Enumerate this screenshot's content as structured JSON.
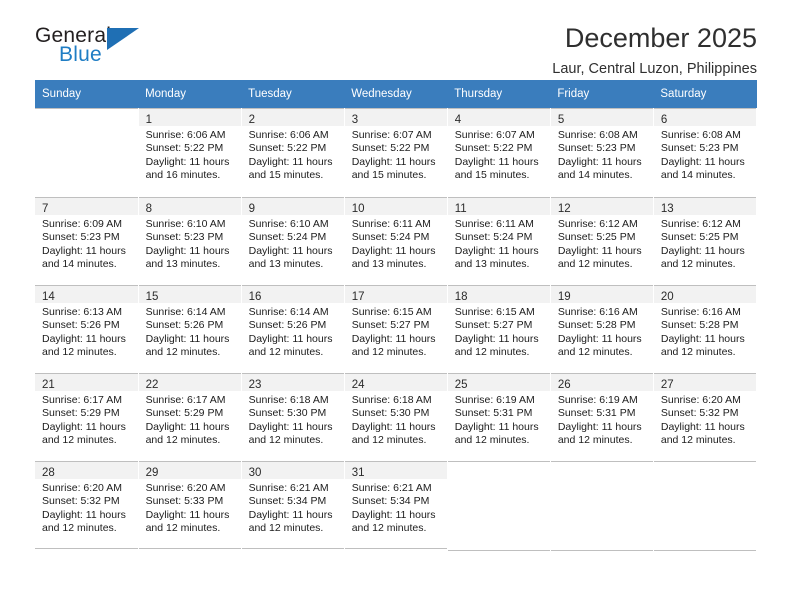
{
  "logo": {
    "word_top": "General",
    "word_bottom": "Blue",
    "triangle_color": "#1f6fb4",
    "blue_color": "#1f7dc4"
  },
  "header": {
    "title": "December 2025",
    "subtitle": "Laur, Central Luzon, Philippines"
  },
  "calendar": {
    "header_bg": "#3a7dbd",
    "daynum_bg": "#f2f2f2",
    "weekday_headers": [
      "Sunday",
      "Monday",
      "Tuesday",
      "Wednesday",
      "Thursday",
      "Friday",
      "Saturday"
    ],
    "weeks": [
      [
        {
          "day": "",
          "sunrise": "",
          "sunset": "",
          "daylight1": "",
          "daylight2": ""
        },
        {
          "day": "1",
          "sunrise": "Sunrise: 6:06 AM",
          "sunset": "Sunset: 5:22 PM",
          "daylight1": "Daylight: 11 hours",
          "daylight2": "and 16 minutes."
        },
        {
          "day": "2",
          "sunrise": "Sunrise: 6:06 AM",
          "sunset": "Sunset: 5:22 PM",
          "daylight1": "Daylight: 11 hours",
          "daylight2": "and 15 minutes."
        },
        {
          "day": "3",
          "sunrise": "Sunrise: 6:07 AM",
          "sunset": "Sunset: 5:22 PM",
          "daylight1": "Daylight: 11 hours",
          "daylight2": "and 15 minutes."
        },
        {
          "day": "4",
          "sunrise": "Sunrise: 6:07 AM",
          "sunset": "Sunset: 5:22 PM",
          "daylight1": "Daylight: 11 hours",
          "daylight2": "and 15 minutes."
        },
        {
          "day": "5",
          "sunrise": "Sunrise: 6:08 AM",
          "sunset": "Sunset: 5:23 PM",
          "daylight1": "Daylight: 11 hours",
          "daylight2": "and 14 minutes."
        },
        {
          "day": "6",
          "sunrise": "Sunrise: 6:08 AM",
          "sunset": "Sunset: 5:23 PM",
          "daylight1": "Daylight: 11 hours",
          "daylight2": "and 14 minutes."
        }
      ],
      [
        {
          "day": "7",
          "sunrise": "Sunrise: 6:09 AM",
          "sunset": "Sunset: 5:23 PM",
          "daylight1": "Daylight: 11 hours",
          "daylight2": "and 14 minutes."
        },
        {
          "day": "8",
          "sunrise": "Sunrise: 6:10 AM",
          "sunset": "Sunset: 5:23 PM",
          "daylight1": "Daylight: 11 hours",
          "daylight2": "and 13 minutes."
        },
        {
          "day": "9",
          "sunrise": "Sunrise: 6:10 AM",
          "sunset": "Sunset: 5:24 PM",
          "daylight1": "Daylight: 11 hours",
          "daylight2": "and 13 minutes."
        },
        {
          "day": "10",
          "sunrise": "Sunrise: 6:11 AM",
          "sunset": "Sunset: 5:24 PM",
          "daylight1": "Daylight: 11 hours",
          "daylight2": "and 13 minutes."
        },
        {
          "day": "11",
          "sunrise": "Sunrise: 6:11 AM",
          "sunset": "Sunset: 5:24 PM",
          "daylight1": "Daylight: 11 hours",
          "daylight2": "and 13 minutes."
        },
        {
          "day": "12",
          "sunrise": "Sunrise: 6:12 AM",
          "sunset": "Sunset: 5:25 PM",
          "daylight1": "Daylight: 11 hours",
          "daylight2": "and 12 minutes."
        },
        {
          "day": "13",
          "sunrise": "Sunrise: 6:12 AM",
          "sunset": "Sunset: 5:25 PM",
          "daylight1": "Daylight: 11 hours",
          "daylight2": "and 12 minutes."
        }
      ],
      [
        {
          "day": "14",
          "sunrise": "Sunrise: 6:13 AM",
          "sunset": "Sunset: 5:26 PM",
          "daylight1": "Daylight: 11 hours",
          "daylight2": "and 12 minutes."
        },
        {
          "day": "15",
          "sunrise": "Sunrise: 6:14 AM",
          "sunset": "Sunset: 5:26 PM",
          "daylight1": "Daylight: 11 hours",
          "daylight2": "and 12 minutes."
        },
        {
          "day": "16",
          "sunrise": "Sunrise: 6:14 AM",
          "sunset": "Sunset: 5:26 PM",
          "daylight1": "Daylight: 11 hours",
          "daylight2": "and 12 minutes."
        },
        {
          "day": "17",
          "sunrise": "Sunrise: 6:15 AM",
          "sunset": "Sunset: 5:27 PM",
          "daylight1": "Daylight: 11 hours",
          "daylight2": "and 12 minutes."
        },
        {
          "day": "18",
          "sunrise": "Sunrise: 6:15 AM",
          "sunset": "Sunset: 5:27 PM",
          "daylight1": "Daylight: 11 hours",
          "daylight2": "and 12 minutes."
        },
        {
          "day": "19",
          "sunrise": "Sunrise: 6:16 AM",
          "sunset": "Sunset: 5:28 PM",
          "daylight1": "Daylight: 11 hours",
          "daylight2": "and 12 minutes."
        },
        {
          "day": "20",
          "sunrise": "Sunrise: 6:16 AM",
          "sunset": "Sunset: 5:28 PM",
          "daylight1": "Daylight: 11 hours",
          "daylight2": "and 12 minutes."
        }
      ],
      [
        {
          "day": "21",
          "sunrise": "Sunrise: 6:17 AM",
          "sunset": "Sunset: 5:29 PM",
          "daylight1": "Daylight: 11 hours",
          "daylight2": "and 12 minutes."
        },
        {
          "day": "22",
          "sunrise": "Sunrise: 6:17 AM",
          "sunset": "Sunset: 5:29 PM",
          "daylight1": "Daylight: 11 hours",
          "daylight2": "and 12 minutes."
        },
        {
          "day": "23",
          "sunrise": "Sunrise: 6:18 AM",
          "sunset": "Sunset: 5:30 PM",
          "daylight1": "Daylight: 11 hours",
          "daylight2": "and 12 minutes."
        },
        {
          "day": "24",
          "sunrise": "Sunrise: 6:18 AM",
          "sunset": "Sunset: 5:30 PM",
          "daylight1": "Daylight: 11 hours",
          "daylight2": "and 12 minutes."
        },
        {
          "day": "25",
          "sunrise": "Sunrise: 6:19 AM",
          "sunset": "Sunset: 5:31 PM",
          "daylight1": "Daylight: 11 hours",
          "daylight2": "and 12 minutes."
        },
        {
          "day": "26",
          "sunrise": "Sunrise: 6:19 AM",
          "sunset": "Sunset: 5:31 PM",
          "daylight1": "Daylight: 11 hours",
          "daylight2": "and 12 minutes."
        },
        {
          "day": "27",
          "sunrise": "Sunrise: 6:20 AM",
          "sunset": "Sunset: 5:32 PM",
          "daylight1": "Daylight: 11 hours",
          "daylight2": "and 12 minutes."
        }
      ],
      [
        {
          "day": "28",
          "sunrise": "Sunrise: 6:20 AM",
          "sunset": "Sunset: 5:32 PM",
          "daylight1": "Daylight: 11 hours",
          "daylight2": "and 12 minutes."
        },
        {
          "day": "29",
          "sunrise": "Sunrise: 6:20 AM",
          "sunset": "Sunset: 5:33 PM",
          "daylight1": "Daylight: 11 hours",
          "daylight2": "and 12 minutes."
        },
        {
          "day": "30",
          "sunrise": "Sunrise: 6:21 AM",
          "sunset": "Sunset: 5:34 PM",
          "daylight1": "Daylight: 11 hours",
          "daylight2": "and 12 minutes."
        },
        {
          "day": "31",
          "sunrise": "Sunrise: 6:21 AM",
          "sunset": "Sunset: 5:34 PM",
          "daylight1": "Daylight: 11 hours",
          "daylight2": "and 12 minutes."
        },
        {
          "day": "",
          "sunrise": "",
          "sunset": "",
          "daylight1": "",
          "daylight2": ""
        },
        {
          "day": "",
          "sunrise": "",
          "sunset": "",
          "daylight1": "",
          "daylight2": ""
        },
        {
          "day": "",
          "sunrise": "",
          "sunset": "",
          "daylight1": "",
          "daylight2": ""
        }
      ]
    ]
  }
}
